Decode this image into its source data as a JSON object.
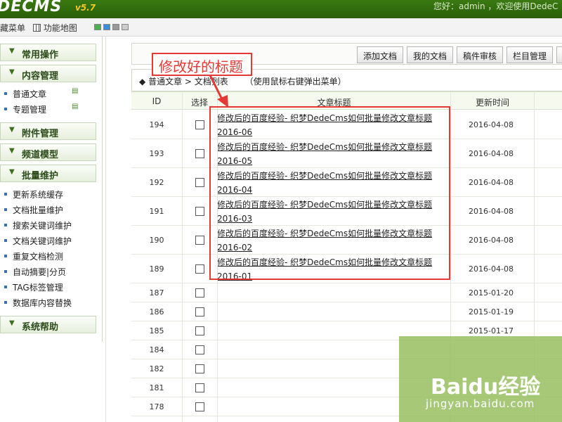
{
  "app": {
    "logo": "DECMS",
    "version": "v5.7",
    "greeting": "您好：admin ，欢迎使用DedeC"
  },
  "menubar": {
    "hide_menu": "藏菜单",
    "map_label": "功能地图"
  },
  "sidebar": {
    "groups": {
      "common": "常用操作",
      "content": "内容管理",
      "attach": "附件管理",
      "channel": "频道模型",
      "batch": "批量维护",
      "help": "系统帮助"
    },
    "content_items": [
      "普通文章",
      "专题管理"
    ],
    "batch_items": [
      "更新系统缓存",
      "文档批量维护",
      "搜索关键词维护",
      "文档关键词维护",
      "重复文档检测",
      "自动摘要|分页",
      "TAG标签管理",
      "数据库内容替换"
    ]
  },
  "toolbar": {
    "add": "添加文档",
    "mine": "我的文档",
    "audit": "稿件审核",
    "column": "栏目管理"
  },
  "breadcrumb": {
    "a": "普通文章",
    "sep": ">",
    "b": "文档列表",
    "hint": "（使用鼠标右键弹出菜单）"
  },
  "table": {
    "headers": {
      "id": "ID",
      "select": "选择",
      "title": "文章标题",
      "updated": "更新时间"
    },
    "rows": [
      {
        "id": "194",
        "title": "修改后的百度经验- 织梦DedeCms如何批量修改文章标题2016-06",
        "date": "2016-04-08"
      },
      {
        "id": "193",
        "title": "修改后的百度经验- 织梦DedeCms如何批量修改文章标题2016-05",
        "date": "2016-04-08"
      },
      {
        "id": "192",
        "title": "修改后的百度经验- 织梦DedeCms如何批量修改文章标题2016-04",
        "date": "2016-04-08"
      },
      {
        "id": "191",
        "title": "修改后的百度经验- 织梦DedeCms如何批量修改文章标题2016-03",
        "date": "2016-04-08"
      },
      {
        "id": "190",
        "title": "修改后的百度经验- 织梦DedeCms如何批量修改文章标题2016-02",
        "date": "2016-04-08"
      },
      {
        "id": "189",
        "title": "修改后的百度经验- 织梦DedeCms如何批量修改文章标题2016-01",
        "date": "2016-04-08"
      },
      {
        "id": "187",
        "title": "",
        "date": "2015-01-20"
      },
      {
        "id": "186",
        "title": "",
        "date": "2015-01-19"
      },
      {
        "id": "185",
        "title": "",
        "date": "2015-01-17"
      },
      {
        "id": "184",
        "title": "",
        "date": ""
      },
      {
        "id": "182",
        "title": "",
        "date": ""
      },
      {
        "id": "181",
        "title": "",
        "date": ""
      },
      {
        "id": "178",
        "title": "",
        "date": ""
      }
    ]
  },
  "annotation": {
    "label": "修改好的标题"
  },
  "watermark": {
    "brand": "Baidu经验",
    "url": "jingyan.baidu.com"
  },
  "colors": {
    "topbar": "#2a5e08",
    "highlight": "#e53935"
  }
}
